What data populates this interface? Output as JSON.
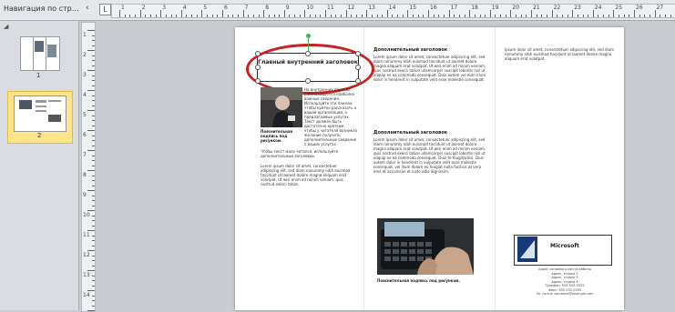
{
  "navigation_panel": {
    "title": "Навигация по стр...",
    "collapse_icon": "chevron-left-icon",
    "pages": [
      {
        "number": "1",
        "selected": false
      },
      {
        "number": "2",
        "selected": true
      }
    ]
  },
  "ruler": {
    "horizontal_numbers": [
      "1",
      "2",
      "3",
      "4",
      "5",
      "6",
      "7",
      "8",
      "9",
      "10",
      "11",
      "12",
      "13",
      "14",
      "15",
      "16",
      "17",
      "18",
      "19",
      "20",
      "21",
      "22",
      "23",
      "24",
      "25",
      "26",
      "27"
    ],
    "vertical_numbers": [
      "1",
      "2",
      "3",
      "4",
      "5",
      "6",
      "7",
      "8",
      "9",
      "10",
      "11",
      "12",
      "13",
      "14",
      "15"
    ]
  },
  "document": {
    "heading_box": "Главный внутренний заголовок",
    "col1_body": "На внутренних панелях рассказывается наиболее важные сведения. Используйте эти панели, чтобы кратко рассказать о вашей организации, о предлагаемых услугах. Текст должен быть достаточно кратким, чтобы у читателя возникло желание получить дополнительные сведения о ваших услугах.",
    "col1_photo_caption": "Пояснительная подпись под рисунком.",
    "col1_body2": "Чтобы текст мало читался, используйте дополнительные заголовки.",
    "col1_lorem": "Lorem ipsum dolor sit amet, consectetuer adipiscing elit, sed diam nonummy nibh euismod tincidunt ut laoreet dolore magna aliquam erat volutpat. Ut wisi enim ad minim veniam, quis nostrud exerci tation.",
    "col2_heading1": "Дополнительный заголовок",
    "col2_heading2": "Дополнительный заголовок",
    "col2_lorem1": "Lorem ipsum dolor sit amet, consectetuer adipiscing elit, sed diam nonummy nibh euismod tincidunt ut laoreet dolore magna aliquam erat volutpat. Ut wisi enim ad minim veniam, quis nostrud exerci tation ullamcorper suscipit lobortis nisl ut aliquip ex ea commodo consequat. Duis autem vel eum iriure dolor in hendrerit in vulputate velit esse molestie consequat.",
    "col2_lorem2": "Lorem ipsum dolor sit amet, consectetuer adipiscing elit, sed diam nonummy nibh euismod tincidunt ut laoreet dolore magna aliquam erat volutpat. Ut wisi enim ad minim veniam, quis nostrud exerci tation ullamcorper suscipit lobortis nisl ut aliquip ex ea commodo consequat. Duis te feugifacilisi. Duis autem dolor in hendrerit in vulputate velit esse molestie consequat, vel illum dolore eu feugiat nulla facilisis at vero eros et accumsan et iusto odio dignissim.",
    "col2_photo_caption": "Пояснительная подпись под рисунком.",
    "col3_lorem": "Ipsum dolor sit amet, consectetuer adipiscing elit, sed diam nonummy nibh euismod tincidunt ut laoreet dolore magna aliquam erat volutpat.",
    "brand": "Microsoft",
    "address": "Адрес основного места работы\nАдрес, строка 2\nАдрес, строка 3\nАдрес, строка 4\nТелефон: 555-555-5555\nФакс: 555-555-5555\nЭл. почта: someone@example.com"
  },
  "colors": {
    "selection_ellipse": "#cc1f1f",
    "selected_thumb": "#ffe48a",
    "rotate_handle": "#3fb64d",
    "logo": "#183a76"
  }
}
